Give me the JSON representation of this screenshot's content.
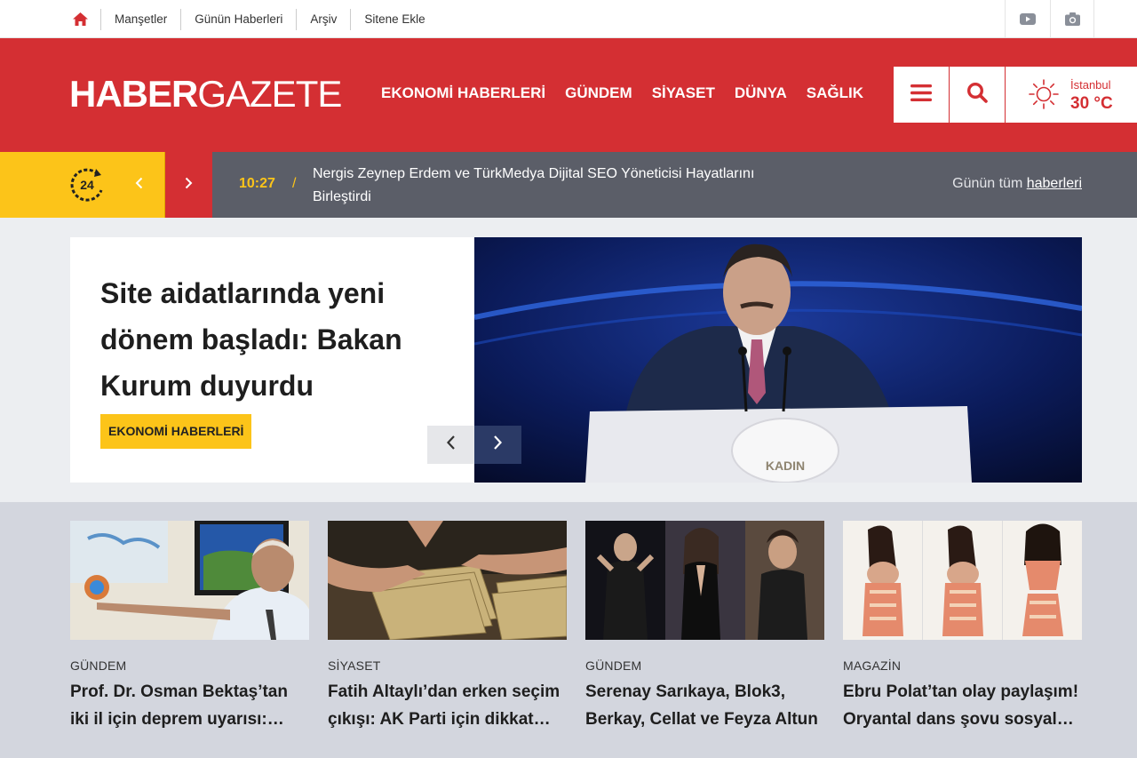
{
  "topbar": {
    "nav": [
      "Manşetler",
      "Günün Haberleri",
      "Arşiv",
      "Sitene Ekle"
    ]
  },
  "header": {
    "logo_bold": "HABER",
    "logo_light": "GAZETE",
    "nav": [
      "EKONOMİ HABERLERİ",
      "GÜNDEM",
      "SİYASET",
      "DÜNYA",
      "SAĞLIK"
    ],
    "weather": {
      "city": "İstanbul",
      "temp": "30 °C"
    }
  },
  "ticker": {
    "badge": "24",
    "time": "10:27",
    "separator": "/",
    "headline": "Nergis Zeynep Erdem ve TürkMedya Dijital SEO Yöneticisi Hayatlarını Birleştirdi",
    "all_prefix": "Günün tüm ",
    "all_link": "haberleri"
  },
  "feature": {
    "title": "Site aidatlarında yeni dönem başladı: Bakan Kurum duyurdu",
    "category": "EKONOMİ HABERLERİ"
  },
  "cards": [
    {
      "category": "GÜNDEM",
      "title": "Prof. Dr. Osman Bektaş’tan iki il için deprem uyarısı: Bölgede büyük bir risk var"
    },
    {
      "category": "SİYASET",
      "title": "Fatih Altaylı’dan erken seçim çıkışı: AK Parti için dikkat çeken yorum"
    },
    {
      "category": "GÜNDEM",
      "title": "Serenay Sarıkaya, Blok3, Berkay, Cellat ve Feyza Altun"
    },
    {
      "category": "MAGAZİN",
      "title": "Ebru Polat’tan olay paylaşım! Oryantal dans şovu sosyal medyayı salladı"
    }
  ],
  "colors": {
    "brand_red": "#d42f33",
    "accent_yellow": "#fcc419",
    "ticker_gray": "#5b5e68"
  }
}
